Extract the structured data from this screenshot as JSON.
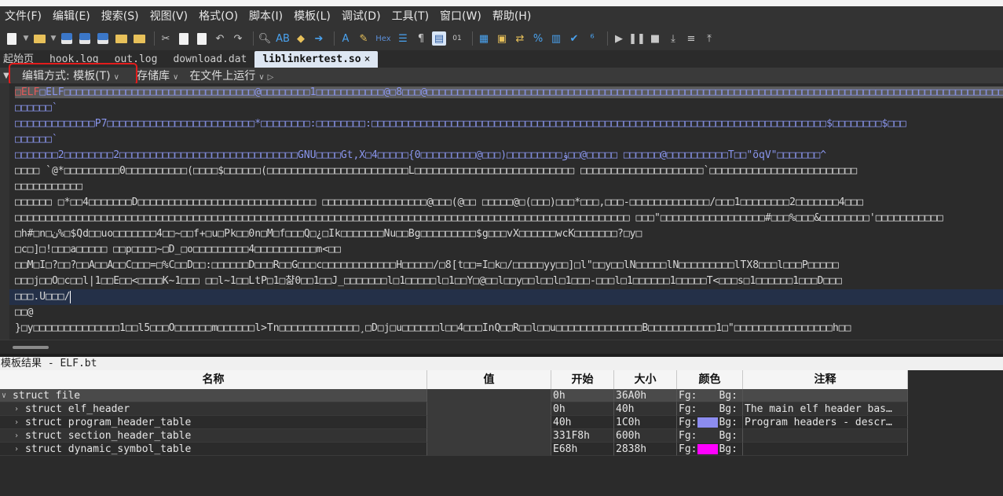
{
  "menu": [
    "文件(F)",
    "编辑(E)",
    "搜索(S)",
    "视图(V)",
    "格式(O)",
    "脚本(I)",
    "模板(L)",
    "调试(D)",
    "工具(T)",
    "窗口(W)",
    "帮助(H)"
  ],
  "toolbar": {
    "hex_label": "Hex"
  },
  "tabs": [
    {
      "label": "起始页"
    },
    {
      "label": "hook.log"
    },
    {
      "label": "out.log"
    },
    {
      "label": "download.dat"
    },
    {
      "label": "liblinkertest.so",
      "close": "×"
    }
  ],
  "filebar": {
    "edit_mode": "编辑方式: 模板(T)",
    "repository": "存储库",
    "run_on_file": "在文件上运行"
  },
  "editor": {
    "lines": [
      "□ELF□□□□□□□□□□□□□□□□□□□□□□□□□□□□□□□@□□□□□□□□1□□□□□□□□□□□@□8□□□@□□□□□□□□□□□□□□□□□□□□□□□□□□□□□□□□□□□□□□□□□□□□□□□□□□□□□□□□□□□□□□□□□□□□□□□□□□□□□□□□□□□□□□□□□□□□□□□□`",
      "□□□□□□`",
      "□□□□□□□□□□□□□P7□□□□□□□□□□□□□□□□□□□□□□□□*□□□□□□□□:□□□□□□□□:□□□□□□□□□□□□□□□□□□□□□□□□□□□□□□□□□□□□□□□□□□□□□□□□□□□□□□□□□□□□□□□□□□□□□□□□□□$□□□□□□□□$□□□",
      "□□□□□□`",
      "□□□□□□□2□□□□□□□□2□□□□□□□□□□□□□□□□□□□□□□□□□□□□□GNU□□□□Gt,X□4□□□□□{ؤ□□□□□□□□□(□□□@□□□□□□□□□0□□@□□□□□  □□□□□□@□□□□□□□□□□T□□\"õqV\"□□□□□□□^",
      "□□□□ `@*□□□□□□□□□0□□□□□□□□□□(□□□□$□□□□□□(□□□□□□□□□□□□□□□□□□□□□□□L□□□□□□□□□□□□□□□□□□□□□□□□□□ □□□□□□□□□□□□□□□□□□□□`□□□□□□□□□□□□□□□□□□□□□□□□",
      "□□□□□□□□□□□",
      " □□□□□□  □*□□4□□□□□□□D□□□□□□□□□□□□□□□□□□□□□□□□□□□□□  □□□□□□□□□□□□□□□□□@□□□(@□□ □□□□□@□(□□□)□□□*□□□,□□□-□□□□□□□□□□□□□/□□□1□□□□□□□□2□□□□□□□4□□□",
      "□□□□□□□□□□□□□□□□□□□□□□□□□□□□□□□□□□□□□□□□□□□□□□□□□□□□□□□□□□□□□□□□□□□□□□□□□□□□□□□□□□□□□□□□□□□□□□□□□□□□ □□□\"□□□□□□□□□□□□□□□□□#□□□%□□□&□□□□□□□□'□□□□□□□□□□□",
      "□h#□n□ن%□$Qd□□uo□□□□□□□4□□~□□f+□u□Pk□□0n□M□f□□□Q□¿□Ik□□□□□□□Nu□□Bg□□□□□□□□□$g□□□vX□□□□□□wcK□□□□□□□?□y□",
      "□c□]□!□□□a□□□□□ □□p□□□□~□D_□o□□□□□□□□□4□□□□□□□□□□m<□□",
      "□□M□I□?□□?□□A□□A□□C□□□=□%C□□D□□:□□□□□□D□□□R□□G□□□c□□□□□□□□□□□□H□□□□□/□8[t□□=I□k□/□□□□□yy□□]□l\"□□y□□lN□□□□□lN□□□□□□□□□lTX8□□□l□□□P□□□□□",
      "□□□j□□O□c□□l|1□□E□□<□□□□K~1□□□ □□l~1□□LtP□1□챪0□□1□□J_□□□□□□□l□1□□□□□l□1□□Y□@□□l□□y□□l□□l□1□□□-□□□l□1□□□□□□1□□□□□T<□□□s□1□□□□□□1□□□D□□□",
      "□□□.U□□□/",
      "□□@",
      "}□y□□□□□□□□□□□□□□1□□l5□□□O□□□□□□m□□□□□□l>Tn□□□□□□□□□□□□□¸□D□j□u□□□□□□l□□4□□□InQ□□R□□l□□u□□□□□□□□□□□□□□B□□□□□□□□□□□1□\"□□□□□□□□□□□□□□□□h□□"
    ]
  },
  "results": {
    "title": "模板结果 - ELF.bt",
    "columns": [
      "名称",
      "值",
      "开始",
      "大小",
      "颜色",
      "注释"
    ],
    "rows": [
      {
        "name": "struct file",
        "value": "",
        "start": "0h",
        "size": "36A0h",
        "fg": "Fg:",
        "bg": "Bg:",
        "fg_color": "",
        "comment": ""
      },
      {
        "name": "struct elf_header",
        "value": "",
        "start": "0h",
        "size": "40h",
        "fg": "Fg:",
        "bg": "Bg:",
        "fg_color": "",
        "comment": "The main elf header bas…"
      },
      {
        "name": "struct program_header_table",
        "value": "",
        "start": "40h",
        "size": "1C0h",
        "fg": "Fg:",
        "bg": "Bg:",
        "fg_color": "#8c8cf0",
        "comment": "Program headers - descr…"
      },
      {
        "name": "struct section_header_table",
        "value": "",
        "start": "331F8h",
        "size": "600h",
        "fg": "Fg:",
        "bg": "Bg:",
        "fg_color": "",
        "comment": ""
      },
      {
        "name": "struct dynamic_symbol_table",
        "value": "",
        "start": "E68h",
        "size": "2838h",
        "fg": "Fg:",
        "bg": "Bg:",
        "fg_color": "#ff00ff",
        "comment": ""
      }
    ]
  },
  "colors": {
    "accent": "#e21c1c",
    "hex_text": "#8a96ee"
  }
}
